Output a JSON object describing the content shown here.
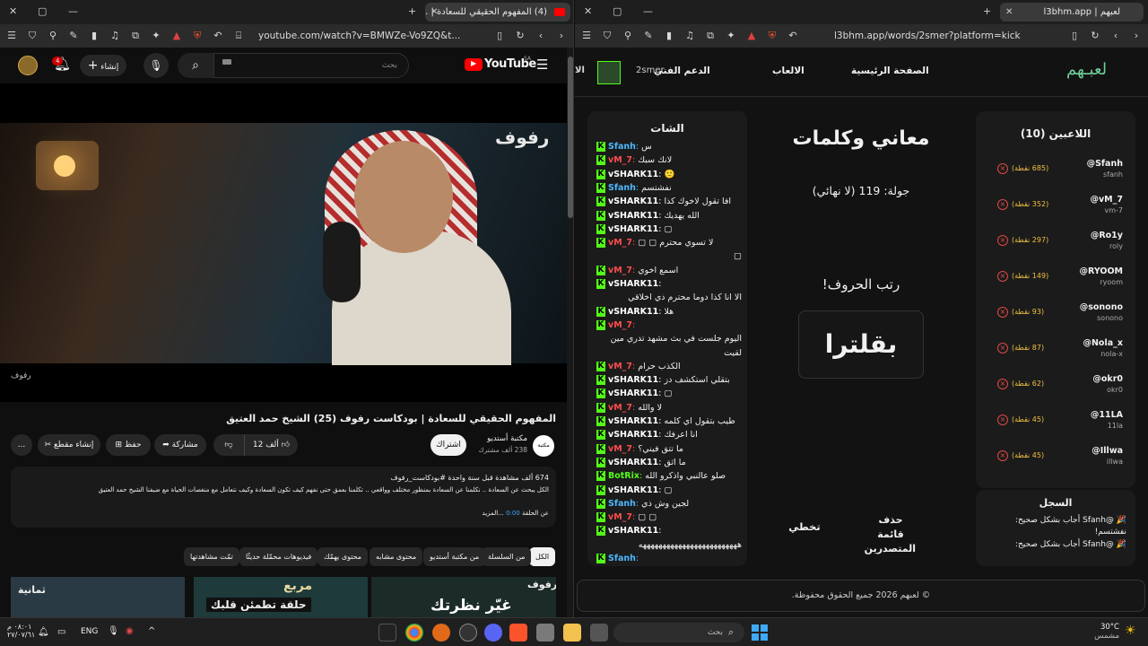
{
  "left_window": {
    "tab_title": "(4) المفهوم الحقيقي للسعادة | ...",
    "url": "youtube.com/watch?v=BMWZe-Vo9ZQ&t...",
    "notif_count": "4",
    "create_label": "إنشاء",
    "search_placeholder": "بحث",
    "logo_text": "YouTube",
    "logo_region": "SA",
    "video_brand": "رفوف",
    "video_watermark": "رفوف",
    "video_title": "المفهوم الحقيقي للسعادة | بودكاست رفوف (25) الشيخ حمد العتيق",
    "channel_name": "مكتبة أستديو",
    "channel_subs": "238 ألف مشترك",
    "channel_avatar_text": "مكتبة",
    "subscribe_label": "اشتراك",
    "like_count": "12 ألف",
    "share_label": "مشاركة",
    "save_label": "حفظ",
    "clip_label": "إنشاء مقطع",
    "more_label": "...",
    "desc_views": "674 ألف مشاهدة  قبل سنة واحدة  #بودكاست_رفوف",
    "desc_text": "الكل يبحث عن السعادة .. نكلمنا عن السعادة بمنظور مختلف وواقعي .. تكلمنا بعمق حتى نفهم كيف تكون السعادة وكيف نتعامل مع منغصات الحياة مع ضيفنا الشيخ حمد العتيق",
    "desc_episode_prefix": "عن الحلقة",
    "desc_timestamp": "0:00",
    "desc_more": "...المزيد",
    "chips": [
      "الكل",
      "من السلسلة",
      "من مكتبة أستديو",
      "محتوى مشابه",
      "محتوى يهمّك",
      "فيديوهات محمّلة حديثًا",
      "تمّت مشاهدتها"
    ],
    "thumb1_text": "حلقة تطمئن قلبك",
    "thumb1_brand": "مربع",
    "thumb2_text": "غيّر نظرتك",
    "thumb2_brand": "رفوف",
    "thumb3_text": "ثمانية"
  },
  "right_window": {
    "tab_title": "لعبهم | l3bhm.app",
    "url": "l3bhm.app/words/2smer?platform=kick",
    "nav": {
      "home": "الصفحة الرئيسية",
      "games": "الالعاب",
      "support": "الدعم الفني",
      "user": "2smer",
      "cut": "الا",
      "logo": "لعبـهم"
    },
    "players_title": "اللاعبين (10)",
    "players": [
      {
        "name": "@Sfanh",
        "sub": "sfanh",
        "points": "(685 نقطة)"
      },
      {
        "name": "@vM_7",
        "sub": "vm-7",
        "points": "(352 نقطة)"
      },
      {
        "name": "@Ro1y",
        "sub": "roly",
        "points": "(297 نقطة)"
      },
      {
        "name": "@RYOOM",
        "sub": "ryoom",
        "points": "(149 نقطة)"
      },
      {
        "name": "@sonono",
        "sub": "sonono",
        "points": "(93 نقطة)"
      },
      {
        "name": "@Nola_x",
        "sub": "nola-x",
        "points": "(87 نقطة)"
      },
      {
        "name": "@okr0",
        "sub": "okr0",
        "points": "(62 نقطة)"
      },
      {
        "name": "@11LA",
        "sub": "11la",
        "points": "(45 نقطة)"
      },
      {
        "name": "@Illwa",
        "sub": "illwa",
        "points": "(45 نقطة)"
      }
    ],
    "log_title": "السجل",
    "log": [
      "🎉 @Sfanh أجاب بشكل صحيح: نفشتسم!",
      "🎉 @Sfanh أجاب بشكل صحيح:"
    ],
    "game_title": "معاني وكلمات",
    "round_text": "جولة: 119 (لا نهائي)",
    "prompt": "رتب الحروف!",
    "scrambled_word": "بقلترا",
    "btn_remove": "حذف قائمة المتصدرين",
    "btn_skip": "تخطي",
    "chat_title": "الشات",
    "chat": [
      {
        "user": "Sfanh",
        "color": "#4db8ff",
        "text": "س"
      },
      {
        "user": "vM_7",
        "color": "#ff4d4d",
        "text": "لانك سبك"
      },
      {
        "user": "vSHARK11",
        "color": "#ffffff",
        "text": "🙁"
      },
      {
        "user": "Sfanh",
        "color": "#4db8ff",
        "text": "نفشتسم"
      },
      {
        "user": "vSHARK11",
        "color": "#ffffff",
        "text": "افا تقول لاخوك كذا"
      },
      {
        "user": "vSHARK11",
        "color": "#ffffff",
        "text": "الله يهديك"
      },
      {
        "user": "vSHARK11",
        "color": "#ffffff",
        "text": "▢"
      },
      {
        "user": "vM_7",
        "color": "#ff4d4d",
        "text": "لا تسوي محترم ▢ ▢"
      },
      {
        "user": "",
        "color": "#ffffff",
        "text": "▢"
      },
      {
        "user": "vM_7",
        "color": "#ff4d4d",
        "text": "اسمع اخوي"
      },
      {
        "user": "vSHARK11",
        "color": "#ffffff",
        "text": ""
      },
      {
        "user": "",
        "color": "#ffffff",
        "text": "الا انا كذا دوما محترم ذي اخلاقي"
      },
      {
        "user": "vSHARK11",
        "color": "#ffffff",
        "text": "هلا"
      },
      {
        "user": "vM_7",
        "color": "#ff4d4d",
        "text": ""
      },
      {
        "user": "",
        "color": "#ffffff",
        "text": "اليوم جلست في بث مشهد تدري مين"
      },
      {
        "user": "",
        "color": "#ffffff",
        "text": "لقيت"
      },
      {
        "user": "vM_7",
        "color": "#ff4d4d",
        "text": "الكذب حرام"
      },
      {
        "user": "vSHARK11",
        "color": "#ffffff",
        "text": "بتقلي استكشف دز"
      },
      {
        "user": "vSHARK11",
        "color": "#ffffff",
        "text": "▢"
      },
      {
        "user": "vM_7",
        "color": "#ff4d4d",
        "text": "لا والله"
      },
      {
        "user": "vSHARK11",
        "color": "#ffffff",
        "text": "طيب بتقول اي كلمه"
      },
      {
        "user": "vSHARK11",
        "color": "#ffffff",
        "text": "انا اعرفك"
      },
      {
        "user": "vM_7",
        "color": "#ff4d4d",
        "text": "ما تتق فيني؟"
      },
      {
        "user": "vSHARK11",
        "color": "#ffffff",
        "text": "ما اثق"
      },
      {
        "user": "BotRix",
        "color": "#53fc18",
        "text": "صلو عالنبي واذكرو الله"
      },
      {
        "user": "vSHARK11",
        "color": "#ffffff",
        "text": "▢"
      },
      {
        "user": "Sfanh",
        "color": "#4db8ff",
        "text": "لجين وش ذي"
      },
      {
        "user": "vM_7",
        "color": "#ff4d4d",
        "text": "▢ ▢"
      },
      {
        "user": "vSHARK11",
        "color": "#ffffff",
        "text": ""
      },
      {
        "user": "",
        "color": "#ffffff",
        "text": "هههههههههههههههههههههههههه"
      },
      {
        "user": "Sfanh",
        "color": "#4db8ff",
        "text": ""
      }
    ],
    "footer": "© لعبهم 2026 جميع الحقوق محفوظة."
  },
  "taskbar": {
    "weather_temp": "30°C",
    "weather_desc": "مشمس",
    "search_placeholder": "بحث",
    "lang": "ENG",
    "time": "٠٨:٠١ م",
    "date": "٢٧/٠٧/٦١"
  },
  "colors": {
    "youtube_red": "#ff0000",
    "kick_green": "#53fc18",
    "points_gold": "#f0c040",
    "remove_red": "#e04848"
  }
}
